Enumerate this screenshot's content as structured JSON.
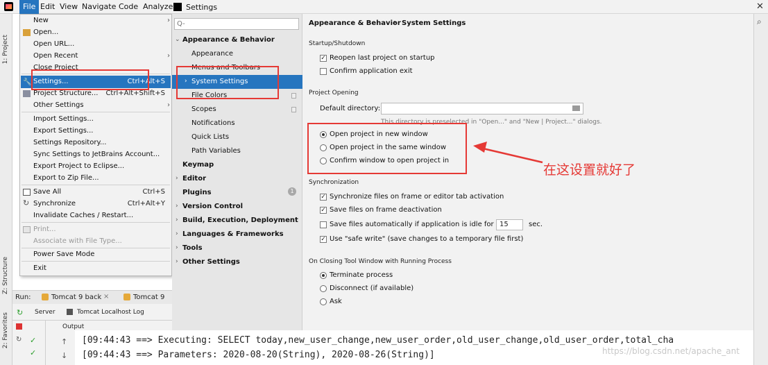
{
  "menubar": {
    "items": [
      "File",
      "Edit",
      "View",
      "Navigate",
      "Code",
      "Analyze"
    ],
    "dialog_title": "Settings"
  },
  "left_strip": {
    "project": "1: Project",
    "structure": "Z: Structure",
    "favorites": "2: Favorites"
  },
  "file_menu": {
    "items": [
      {
        "label": "New",
        "arrow": true
      },
      {
        "label": "Open..."
      },
      {
        "label": "Open URL..."
      },
      {
        "label": "Open Recent",
        "arrow": true
      },
      {
        "label": "Close Project"
      },
      {
        "label": "Settings...",
        "shortcut": "Ctrl+Alt+S",
        "selected": true
      },
      {
        "label": "Project Structure...",
        "shortcut": "Ctrl+Alt+Shift+S"
      },
      {
        "label": "Other Settings",
        "arrow": true
      },
      {
        "label": "Import Settings..."
      },
      {
        "label": "Export Settings..."
      },
      {
        "label": "Settings Repository..."
      },
      {
        "label": "Sync Settings to JetBrains Account..."
      },
      {
        "label": "Export Project to Eclipse..."
      },
      {
        "label": "Export to Zip File..."
      },
      {
        "label": "Save All",
        "shortcut": "Ctrl+S"
      },
      {
        "label": "Synchronize",
        "shortcut": "Ctrl+Alt+Y"
      },
      {
        "label": "Invalidate Caches / Restart..."
      },
      {
        "label": "Print...",
        "disabled": true
      },
      {
        "label": "Associate with File Type...",
        "disabled": true
      },
      {
        "label": "Power Save Mode"
      },
      {
        "label": "Exit"
      }
    ]
  },
  "tree": {
    "search_placeholder": "Q-",
    "items": [
      {
        "label": "Appearance & Behavior",
        "bold": true,
        "expanded": true
      },
      {
        "label": "Appearance"
      },
      {
        "label": "Menus and Toolbars"
      },
      {
        "label": "System Settings",
        "selected": true
      },
      {
        "label": "File Colors"
      },
      {
        "label": "Scopes"
      },
      {
        "label": "Notifications"
      },
      {
        "label": "Quick Lists"
      },
      {
        "label": "Path Variables"
      },
      {
        "label": "Keymap",
        "bold": true
      },
      {
        "label": "Editor",
        "bold": true
      },
      {
        "label": "Plugins",
        "bold": true,
        "badge": "1"
      },
      {
        "label": "Version Control",
        "bold": true
      },
      {
        "label": "Build, Execution, Deployment",
        "bold": true
      },
      {
        "label": "Languages & Frameworks",
        "bold": true
      },
      {
        "label": "Tools",
        "bold": true
      },
      {
        "label": "Other Settings",
        "bold": true
      }
    ]
  },
  "content": {
    "breadcrumb": [
      "Appearance & Behavior",
      "System Settings"
    ],
    "breadcrumb_sep": "›",
    "startup": {
      "header": "Startup/Shutdown",
      "reopen": {
        "label": "Reopen last project on startup",
        "checked": true
      },
      "confirm_exit": {
        "label": "Confirm application exit",
        "checked": false
      }
    },
    "project_opening": {
      "header": "Project Opening",
      "default_dir_label": "Default directory:",
      "default_dir_value": "",
      "note": "This directory is preselected in \"Open...\" and \"New | Project...\" dialogs.",
      "options": [
        {
          "label": "Open project in new window",
          "selected": true
        },
        {
          "label": "Open project in the same window",
          "selected": false
        },
        {
          "label": "Confirm window to open project in",
          "selected": false
        }
      ]
    },
    "sync": {
      "header": "Synchronization",
      "frame": {
        "label": "Synchronize files on frame or editor tab activation",
        "checked": true
      },
      "deact": {
        "label": "Save files on frame deactivation",
        "checked": true
      },
      "idle": {
        "label": "Save files automatically if application is idle for",
        "checked": false,
        "value": "15",
        "unit": "sec."
      },
      "safe": {
        "label": "Use \"safe write\" (save changes to a temporary file first)",
        "checked": true
      }
    },
    "closing": {
      "header": "On Closing Tool Window with Running Process",
      "options": [
        {
          "label": "Terminate process",
          "selected": true
        },
        {
          "label": "Disconnect (if available)",
          "selected": false
        },
        {
          "label": "Ask",
          "selected": false
        }
      ]
    }
  },
  "annotation": {
    "text": "在这设置就好了",
    "color": "#e53935"
  },
  "run_panel": {
    "label": "Run:",
    "tabs": [
      "Tomcat 9 back",
      "Tomcat 9"
    ],
    "subtabs": [
      "Server",
      "Tomcat Localhost Log"
    ],
    "output_label": "Output"
  },
  "console": {
    "lines": [
      "[09:44:43 ==>  Executing: SELECT today,new_user_change,new_user_order,old_user_change,old_user_order,total_cha",
      "[09:44:43 ==> Parameters: 2020-08-20(String), 2020-08-26(String)]"
    ]
  },
  "watermark": "https://blog.csdn.net/apache_ant",
  "colors": {
    "selection": "#2675bf",
    "annotation_red": "#e53935"
  }
}
